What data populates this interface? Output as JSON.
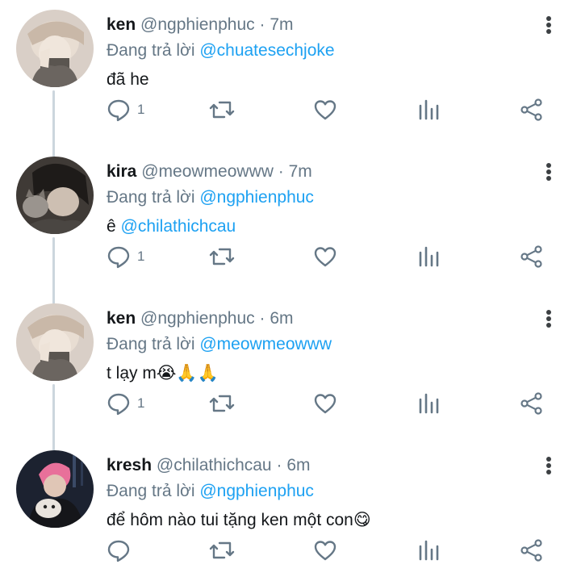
{
  "tweets": [
    {
      "name": "ken",
      "handle": "@ngphienphuc",
      "separator": "·",
      "time": "7m",
      "reply_prefix": "Đang trả lời",
      "reply_mention": "@chuatesechjoke",
      "text": "đã he",
      "text_mention": "",
      "text_emoji": "",
      "reply_count": "1",
      "avatar": "avatar-ken"
    },
    {
      "name": "kira",
      "handle": "@meowmeowww",
      "separator": "·",
      "time": "7m",
      "reply_prefix": "Đang trả lời",
      "reply_mention": "@ngphienphuc",
      "text": "ê ",
      "text_mention": "@chilathichcau",
      "text_emoji": "",
      "reply_count": "1",
      "avatar": "avatar-kira"
    },
    {
      "name": "ken",
      "handle": "@ngphienphuc",
      "separator": "·",
      "time": "6m",
      "reply_prefix": "Đang trả lời",
      "reply_mention": "@meowmeowww",
      "text": "t lạy m",
      "text_mention": "",
      "text_emoji": "😭🙏🙏",
      "reply_count": "1",
      "avatar": "avatar-ken"
    },
    {
      "name": "kresh",
      "handle": "@chilathichcau",
      "separator": "·",
      "time": "6m",
      "reply_prefix": "Đang trả lời",
      "reply_mention": "@ngphienphuc",
      "text": "để hôm nào tui tặng ken một con",
      "text_mention": "",
      "text_emoji": "😋",
      "reply_count": "",
      "avatar": "avatar-kresh"
    }
  ],
  "icons": {
    "reply": "reply-icon",
    "retweet": "retweet-icon",
    "like": "heart-icon",
    "stats": "stats-icon",
    "share": "share-icon",
    "more": "more-vertical-icon"
  },
  "colors": {
    "text": "#14171a",
    "secondary": "#657786",
    "mention": "#1da1f2",
    "thread_line": "#ccd6dd",
    "icon": "#657786"
  }
}
